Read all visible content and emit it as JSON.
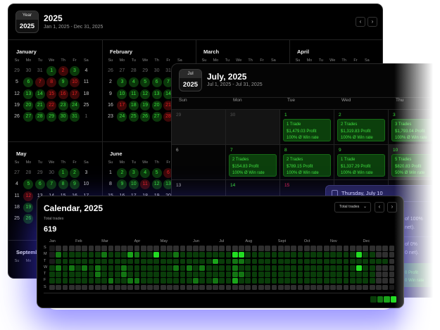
{
  "year_view": {
    "badge_top": "Year",
    "badge_bottom": "2025",
    "title": "2025",
    "subtitle": "Jan 1, 2025 - Dec 31, 2025",
    "prev": "‹",
    "next": "›",
    "weekdays": [
      "Su",
      "Mo",
      "Tu",
      "We",
      "Th",
      "Fr",
      "Sa"
    ],
    "months": [
      {
        "name": "January",
        "lead": [
          29,
          30,
          31
        ],
        "days": 31,
        "trail": [
          1
        ],
        "wins": [
          1,
          3,
          6,
          9,
          13,
          14,
          20,
          21,
          23,
          24,
          27,
          28,
          29,
          30,
          31
        ],
        "losses": [
          2,
          7,
          8,
          10,
          15,
          16,
          17,
          22
        ]
      },
      {
        "name": "February",
        "lead": [
          26,
          27,
          28,
          29,
          30,
          31
        ],
        "days": 28,
        "trail": [
          1
        ],
        "wins": [
          3,
          4,
          5,
          6,
          7,
          10,
          11,
          12,
          13,
          14,
          18,
          19,
          20,
          24,
          25,
          26,
          27
        ],
        "losses": [
          17,
          21,
          28
        ]
      },
      {
        "name": "March",
        "lead": [],
        "days": 0,
        "trail": [],
        "wins": [],
        "losses": []
      },
      {
        "name": "April",
        "lead": [],
        "days": 0,
        "trail": [],
        "wins": [],
        "losses": []
      },
      {
        "name": "May",
        "lead": [
          27,
          28,
          29,
          30
        ],
        "days": 31,
        "trail": [],
        "wins": [
          1,
          2,
          5,
          6,
          7,
          8,
          9,
          19,
          26
        ],
        "losses": [
          12
        ]
      },
      {
        "name": "June",
        "lead": [],
        "days": 30,
        "trail": [
          1,
          2,
          3,
          4,
          5
        ],
        "wins": [
          2,
          3,
          4,
          5,
          9,
          10,
          12,
          13
        ],
        "losses": [
          6,
          11
        ]
      },
      {
        "name": "September",
        "lead": [],
        "days": 0,
        "trail": [],
        "wins": [],
        "losses": []
      }
    ]
  },
  "month_view": {
    "badge_top": "Jul",
    "badge_bottom": "2025",
    "title": "July, 2025",
    "subtitle": "Jul 1, 2025 - Jul 31, 2025",
    "weekdays": [
      "Sun",
      "Mon",
      "Tue",
      "Wed",
      "Thu"
    ],
    "weeks": [
      [
        {
          "d": "29",
          "o": true
        },
        {
          "d": "30",
          "o": true
        },
        {
          "d": "1",
          "s": "g",
          "card": [
            "1 Trade",
            "$1,479.03 Profit",
            "100% Ø Win rate"
          ]
        },
        {
          "d": "2",
          "s": "g",
          "card": [
            "2 Trades",
            "$1,319.83 Profit",
            "100% Ø Win rate"
          ]
        },
        {
          "d": "3",
          "s": "g",
          "card": [
            "3 Trades",
            "$1,793.04 Profit",
            "100% Ø Win rate"
          ]
        }
      ],
      [
        {
          "d": "6"
        },
        {
          "d": "7",
          "s": "g",
          "card": [
            "2 Trades",
            "$154.83 Profit",
            "100% Ø Win rate"
          ]
        },
        {
          "d": "8",
          "s": "g",
          "card": [
            "2 Trades",
            "$789.15 Profit",
            "100% Ø Win rate"
          ]
        },
        {
          "d": "9",
          "s": "g",
          "card": [
            "1 Trade",
            "$1,337.29 Profit",
            "100% Ø Win rate"
          ]
        },
        {
          "d": "10",
          "s": "g",
          "sel": true,
          "card": [
            "5 Trades",
            "$820.83 Profit",
            "50% Ø Win rate"
          ]
        }
      ],
      [
        {
          "d": "13"
        },
        {
          "d": "14",
          "s": "g"
        },
        {
          "d": "15",
          "s": "r"
        },
        {
          "d": ""
        },
        {
          "d": ""
        }
      ]
    ]
  },
  "details": {
    "title": "Thursday, July 10",
    "line1a": "of 100%",
    "line1b": "net).",
    "line2a": "of 0%",
    "line2b": "0 net).",
    "card_profit": "0 Profit",
    "card_winrate": "0 Win rate"
  },
  "heatmap": {
    "title": "Calendar, 2025",
    "metric_label": "Total trades",
    "total": "619",
    "dropdown": "Total trades",
    "prev": "‹",
    "next": "›",
    "day_labels": [
      "S",
      "M",
      "T",
      "W",
      "T",
      "F",
      "S"
    ],
    "month_labels": [
      {
        "label": "Jan",
        "week": 0
      },
      {
        "label": "Feb",
        "week": 4
      },
      {
        "label": "Mar",
        "week": 8
      },
      {
        "label": "Apr",
        "week": 13
      },
      {
        "label": "May",
        "week": 17
      },
      {
        "label": "Jun",
        "week": 22
      },
      {
        "label": "Jul",
        "week": 26
      },
      {
        "label": "Aug",
        "week": 30
      },
      {
        "label": "Sept",
        "week": 35
      },
      {
        "label": "Oct",
        "week": 39
      },
      {
        "label": "Nov",
        "week": 43
      },
      {
        "label": "Dec",
        "week": 48
      }
    ],
    "levels": [
      "x0000000000000000000000000000000000000000000000000000",
      "x2111111211132114112111111114411111111111111111411000",
      "x111111111111111111111111311221111111111111111111111000",
      "12121212111211111112121211112111111111111111111411000",
      "11111112111211111111111111112211111111111111111111000x",
      "11111111121122111111112112113111111111111111111111000x",
      "0000000000000000000000000000000000000000000000000000x"
    ],
    "legend_levels": [
      1,
      2,
      3,
      4
    ]
  },
  "colors": {
    "win": "#3be03b",
    "loss": "#e52222",
    "accent_glow": "#4a3cff"
  }
}
